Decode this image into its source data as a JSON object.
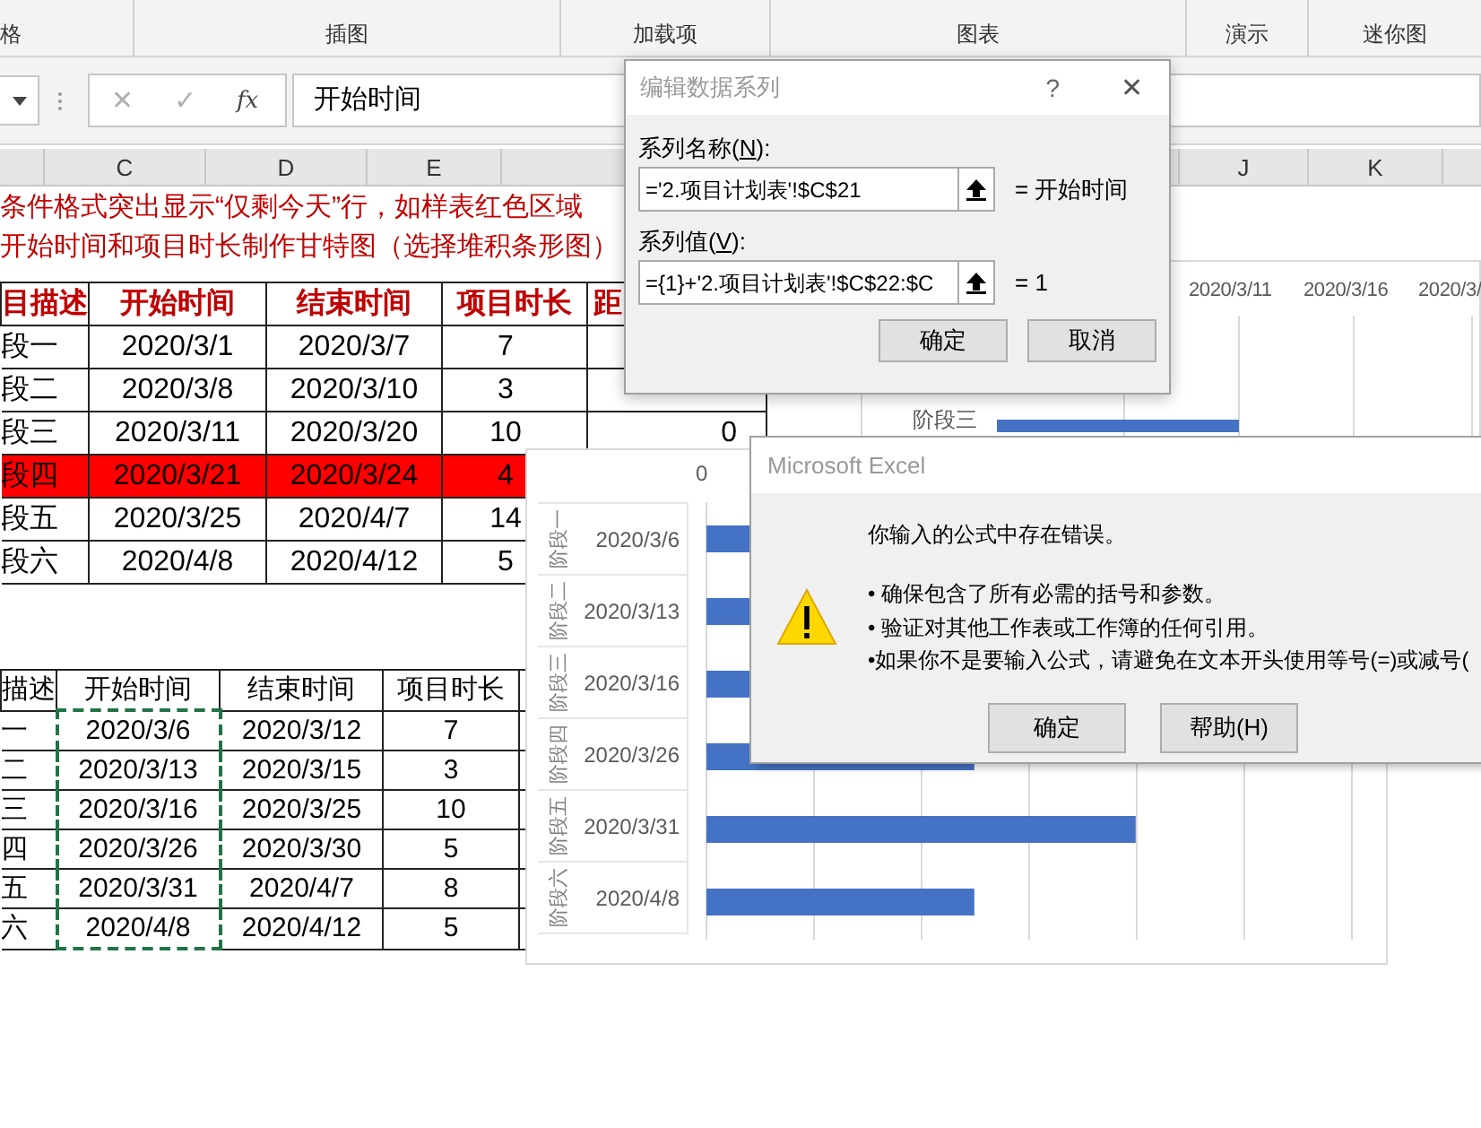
{
  "ribbon": {
    "groups": [
      "格",
      "插图",
      "加载项",
      "图表",
      "演示",
      "迷你图"
    ]
  },
  "formula_bar": {
    "cancel": "✕",
    "enter": "✓",
    "function": "fx",
    "value": "开始时间"
  },
  "column_headers": [
    "C",
    "D",
    "E",
    "J",
    "K"
  ],
  "notes": [
    "条件格式突出显示“仅剩今天”行，如样表红色区域",
    "开始时间和项目时长制作甘特图（选择堆积条形图）"
  ],
  "table1": {
    "columns": [
      "目描述",
      "开始时间",
      "结束时间",
      "项目时长",
      "距"
    ],
    "rows": [
      {
        "cells": [
          "段一",
          "2020/3/1",
          "2020/3/7",
          "7",
          ""
        ],
        "highlighted": false
      },
      {
        "cells": [
          "段二",
          "2020/3/8",
          "2020/3/10",
          "3",
          ""
        ],
        "highlighted": false
      },
      {
        "cells": [
          "段三",
          "2020/3/11",
          "2020/3/20",
          "10",
          "0"
        ],
        "highlighted": false
      },
      {
        "cells": [
          "段四",
          "2020/3/21",
          "2020/3/24",
          "4",
          ""
        ],
        "highlighted": true
      },
      {
        "cells": [
          "段五",
          "2020/3/25",
          "2020/4/7",
          "14",
          ""
        ],
        "highlighted": false
      },
      {
        "cells": [
          "段六",
          "2020/4/8",
          "2020/4/12",
          "5",
          ""
        ],
        "highlighted": false
      }
    ]
  },
  "table2": {
    "columns": [
      "描述",
      "开始时间",
      "结束时间",
      "项目时长",
      ""
    ],
    "rows": [
      [
        "一",
        "2020/3/6",
        "2020/3/12",
        "7",
        ""
      ],
      [
        "二",
        "2020/3/13",
        "2020/3/15",
        "3",
        ""
      ],
      [
        "三",
        "2020/3/16",
        "2020/3/25",
        "10",
        ""
      ],
      [
        "四",
        "2020/3/26",
        "2020/3/30",
        "5",
        ""
      ],
      [
        "五",
        "2020/3/31",
        "2020/4/7",
        "8",
        ""
      ],
      [
        "六",
        "2020/4/8",
        "2020/4/12",
        "5",
        ""
      ]
    ]
  },
  "chart_back": {
    "axis_labels": [
      "2020/3/11",
      "2020/3/16",
      "2020/3/"
    ],
    "category": "阶段三"
  },
  "chart_front": {
    "axis_label": "0",
    "categories": [
      {
        "stage": "阶段一",
        "date": "2020/3/6"
      },
      {
        "stage": "阶段二",
        "date": "2020/3/13"
      },
      {
        "stage": "阶段三",
        "date": "2020/3/16"
      },
      {
        "stage": "阶段四",
        "date": "2020/3/26"
      },
      {
        "stage": "阶段五",
        "date": "2020/3/31"
      },
      {
        "stage": "阶段六",
        "date": "2020/4/8"
      }
    ]
  },
  "series_dialog": {
    "title": "编辑数据系列",
    "help": "?",
    "close": "✕",
    "fields": [
      {
        "label": [
          "系列名称(",
          "N",
          "):"
        ],
        "value": "='2.项目计划表'!$C$21",
        "result": "= 开始时间"
      },
      {
        "label": [
          "系列值(",
          "V",
          "):"
        ],
        "value": "={1}+'2.项目计划表'!$C$22:$C",
        "result": "= 1"
      }
    ],
    "buttons": [
      "确定",
      "取消"
    ]
  },
  "error_dialog": {
    "title": "Microsoft Excel",
    "message": "你输入的公式中存在错误。",
    "bullets": [
      "• 确保包含了所有必需的括号和参数。",
      "• 验证对其他工作表或工作簿的任何引用。",
      "•如果你不是要输入公式，请避免在文本开头使用等号(=)或减号("
    ],
    "buttons": [
      "确定",
      "帮助(H)"
    ]
  }
}
